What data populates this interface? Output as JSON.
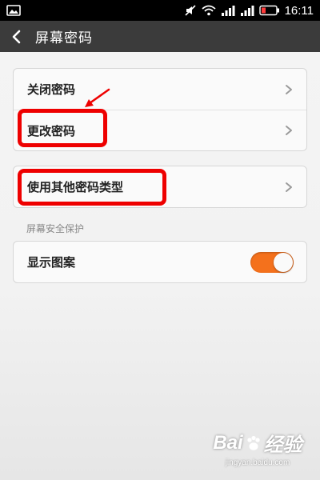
{
  "status_bar": {
    "time": "16:11"
  },
  "action_bar": {
    "title": "屏幕密码"
  },
  "group1": {
    "items": [
      {
        "label": "关闭密码"
      },
      {
        "label": "更改密码"
      }
    ]
  },
  "group2": {
    "label": "使用其他密码类型"
  },
  "section_header": "屏幕安全保护",
  "group3": {
    "label": "显示图案",
    "toggle_on": true
  },
  "watermark": {
    "brand_left": "Bai",
    "brand_right": "经验",
    "url": "jingyan.baidu.com"
  },
  "colors": {
    "toggle_on": "#f4711c",
    "highlight": "#ee0000",
    "action_bar": "#3b3b3b"
  }
}
